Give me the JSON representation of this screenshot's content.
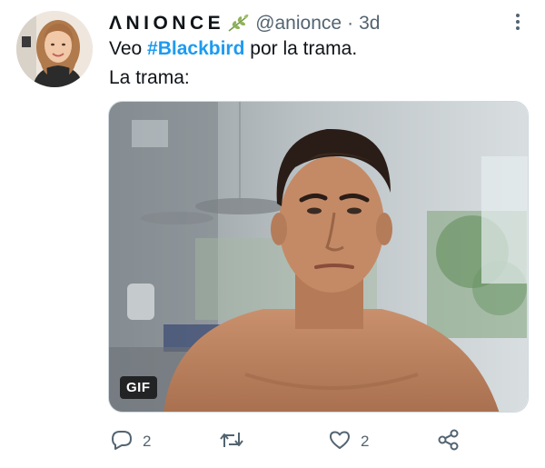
{
  "tweet": {
    "author": {
      "display_name": "ΛNIONCE",
      "name_emoji": "leaf-branch-icon",
      "handle": "@anionce",
      "separator": "·",
      "time": "3d"
    },
    "text": {
      "line1_prefix": "Veo ",
      "hashtag": "#Blackbird",
      "line1_suffix": " por la trama.",
      "line2": "La trama:"
    },
    "media": {
      "type": "gif",
      "badge": "GIF"
    },
    "actions": {
      "reply_count": "2",
      "retweet_count": "",
      "like_count": "2"
    },
    "colors": {
      "accent": "#1d9bf0",
      "secondary_text": "#536471",
      "primary_text": "#0f1419"
    }
  }
}
